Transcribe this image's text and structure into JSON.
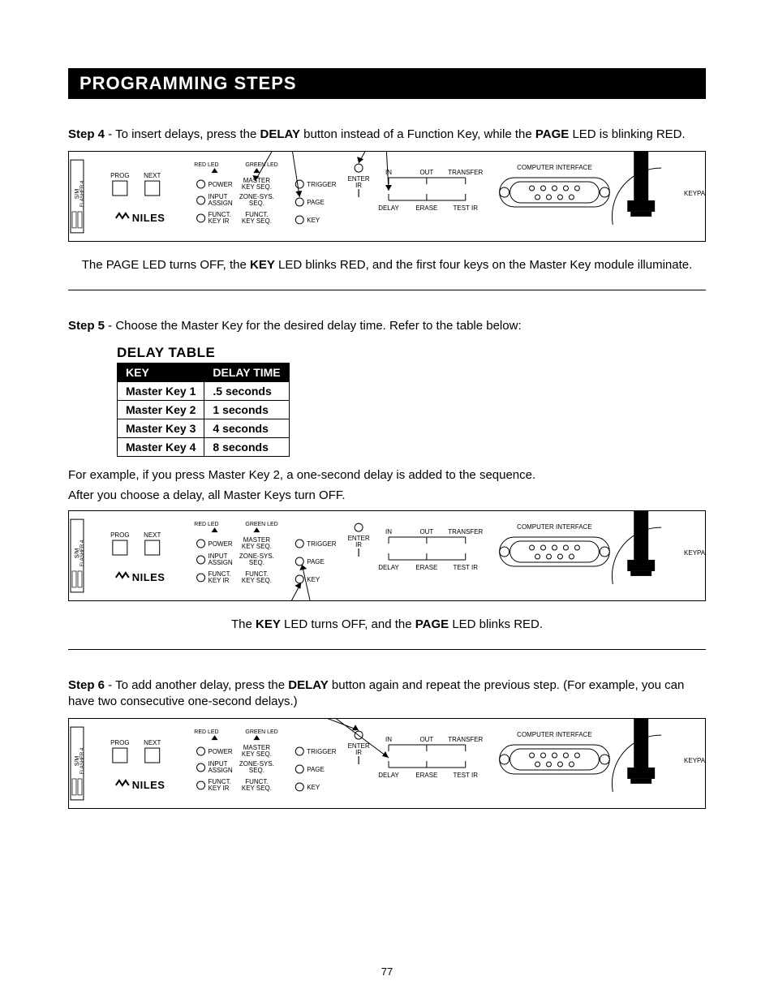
{
  "banner": "PROGRAMMING STEPS",
  "step4": {
    "label": "Step 4",
    "text_a": " - To insert delays, press the ",
    "bold_a": "DELAY",
    "text_b": " button instead of a Function Key, while the ",
    "bold_b": "PAGE",
    "text_c": " LED is blinking RED."
  },
  "caption4_a": "The PAGE LED turns OFF, the ",
  "caption4_bold": "KEY",
  "caption4_b": " LED blinks RED, and the first four keys on the Master Key module illuminate.",
  "step5": {
    "label": "Step 5",
    "text": " - Choose the Master Key for the desired delay time. Refer to the table below:"
  },
  "delay_table": {
    "title": "DELAY TABLE",
    "headers": [
      "KEY",
      "DELAY TIME"
    ],
    "rows": [
      [
        "Master Key 1",
        ".5 seconds"
      ],
      [
        "Master Key 2",
        "1 seconds"
      ],
      [
        "Master Key 3",
        "4 seconds"
      ],
      [
        "Master Key 4",
        "8 seconds"
      ]
    ]
  },
  "example_text": "For example, if you press Master Key 2, a one-second delay is added to the sequence.",
  "after_text": "After you choose a delay, all Master Keys turn OFF.",
  "caption5_a": "The ",
  "caption5_bold1": "KEY",
  "caption5_b": " LED turns OFF, and the ",
  "caption5_bold2": "PAGE",
  "caption5_c": " LED blinks RED.",
  "step6": {
    "label": "Step 6",
    "text_a": " - To add another delay, press the ",
    "bold_a": "DELAY",
    "text_b": " button again and repeat the previous step. (For example, you can have two consecutive one-second delays.)"
  },
  "panel": {
    "prog": "PROG",
    "next": "NEXT",
    "brand": "NILES",
    "red_led": "RED LED",
    "green_led": "GREEN LED",
    "power": "POWER",
    "input_assign1": "INPUT",
    "input_assign2": "ASSIGN",
    "funct_key_ir1": "FUNCT.",
    "funct_key_ir2": "KEY IR",
    "master_key_seq1": "MASTER",
    "master_key_seq2": "KEY SEQ.",
    "zone_sys_seq1": "ZONE-SYS.",
    "zone_sys_seq2": "SEQ.",
    "funct_key_seq1": "FUNCT.",
    "funct_key_seq2": "KEY SEQ.",
    "trigger": "TRIGGER",
    "page": "PAGE",
    "key": "KEY",
    "enter_ir1": "ENTER",
    "enter_ir2": "IR",
    "in": "IN",
    "out": "OUT",
    "transfer": "TRANSFER",
    "delay": "DELAY",
    "erase": "ERASE",
    "test_ir": "TEST IR",
    "computer_interface": "COMPUTER INTERFACE",
    "keypad": "KEYPAD",
    "model1": "S/M",
    "model2": "FLASHER 4"
  },
  "page_number": "77"
}
